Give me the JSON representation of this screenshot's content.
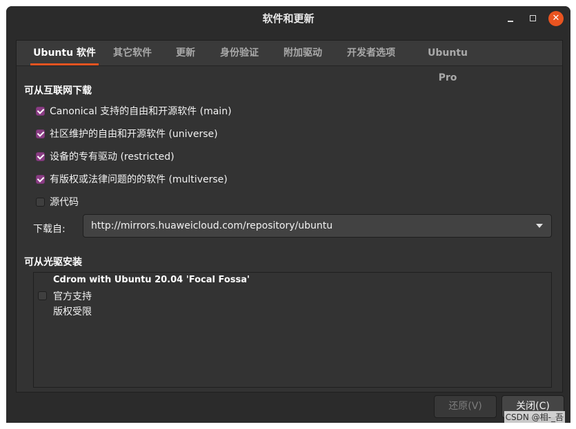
{
  "window": {
    "title": "软件和更新",
    "close_glyph": "✕"
  },
  "tabs": [
    {
      "label": "Ubuntu 软件",
      "active": true
    },
    {
      "label": "其它软件",
      "active": false
    },
    {
      "label": "更新",
      "active": false
    },
    {
      "label": "身份验证",
      "active": false
    },
    {
      "label": "附加驱动",
      "active": false
    },
    {
      "label": "开发者选项",
      "active": false
    },
    {
      "label": "Ubuntu Pro",
      "active": false
    }
  ],
  "internet": {
    "section_title": "可从互联网下载",
    "options": [
      {
        "label": "Canonical 支持的自由和开源软件 (main)",
        "checked": true
      },
      {
        "label": "社区维护的自由和开源软件 (universe)",
        "checked": true
      },
      {
        "label": "设备的专有驱动 (restricted)",
        "checked": true
      },
      {
        "label": "有版权或法律问题的的软件 (multiverse)",
        "checked": true
      },
      {
        "label": "源代码",
        "checked": false
      }
    ],
    "download_from_label": "下载自:",
    "download_from_value": "http://mirrors.huaweicloud.com/repository/ubuntu"
  },
  "cdrom": {
    "section_title": "可从光驱安装",
    "entry_title": "Cdrom with Ubuntu 20.04 'Focal Fossa'",
    "line1": "官方支持",
    "line2": "版权受限",
    "checked": false
  },
  "buttons": {
    "revert": "还原(V)",
    "close": "关闭(C)"
  },
  "watermark": "CSDN @相-_吾",
  "colors": {
    "accent": "#e95420",
    "checkbox_checked": "#8a3d84",
    "background": "#2b2b2b"
  }
}
